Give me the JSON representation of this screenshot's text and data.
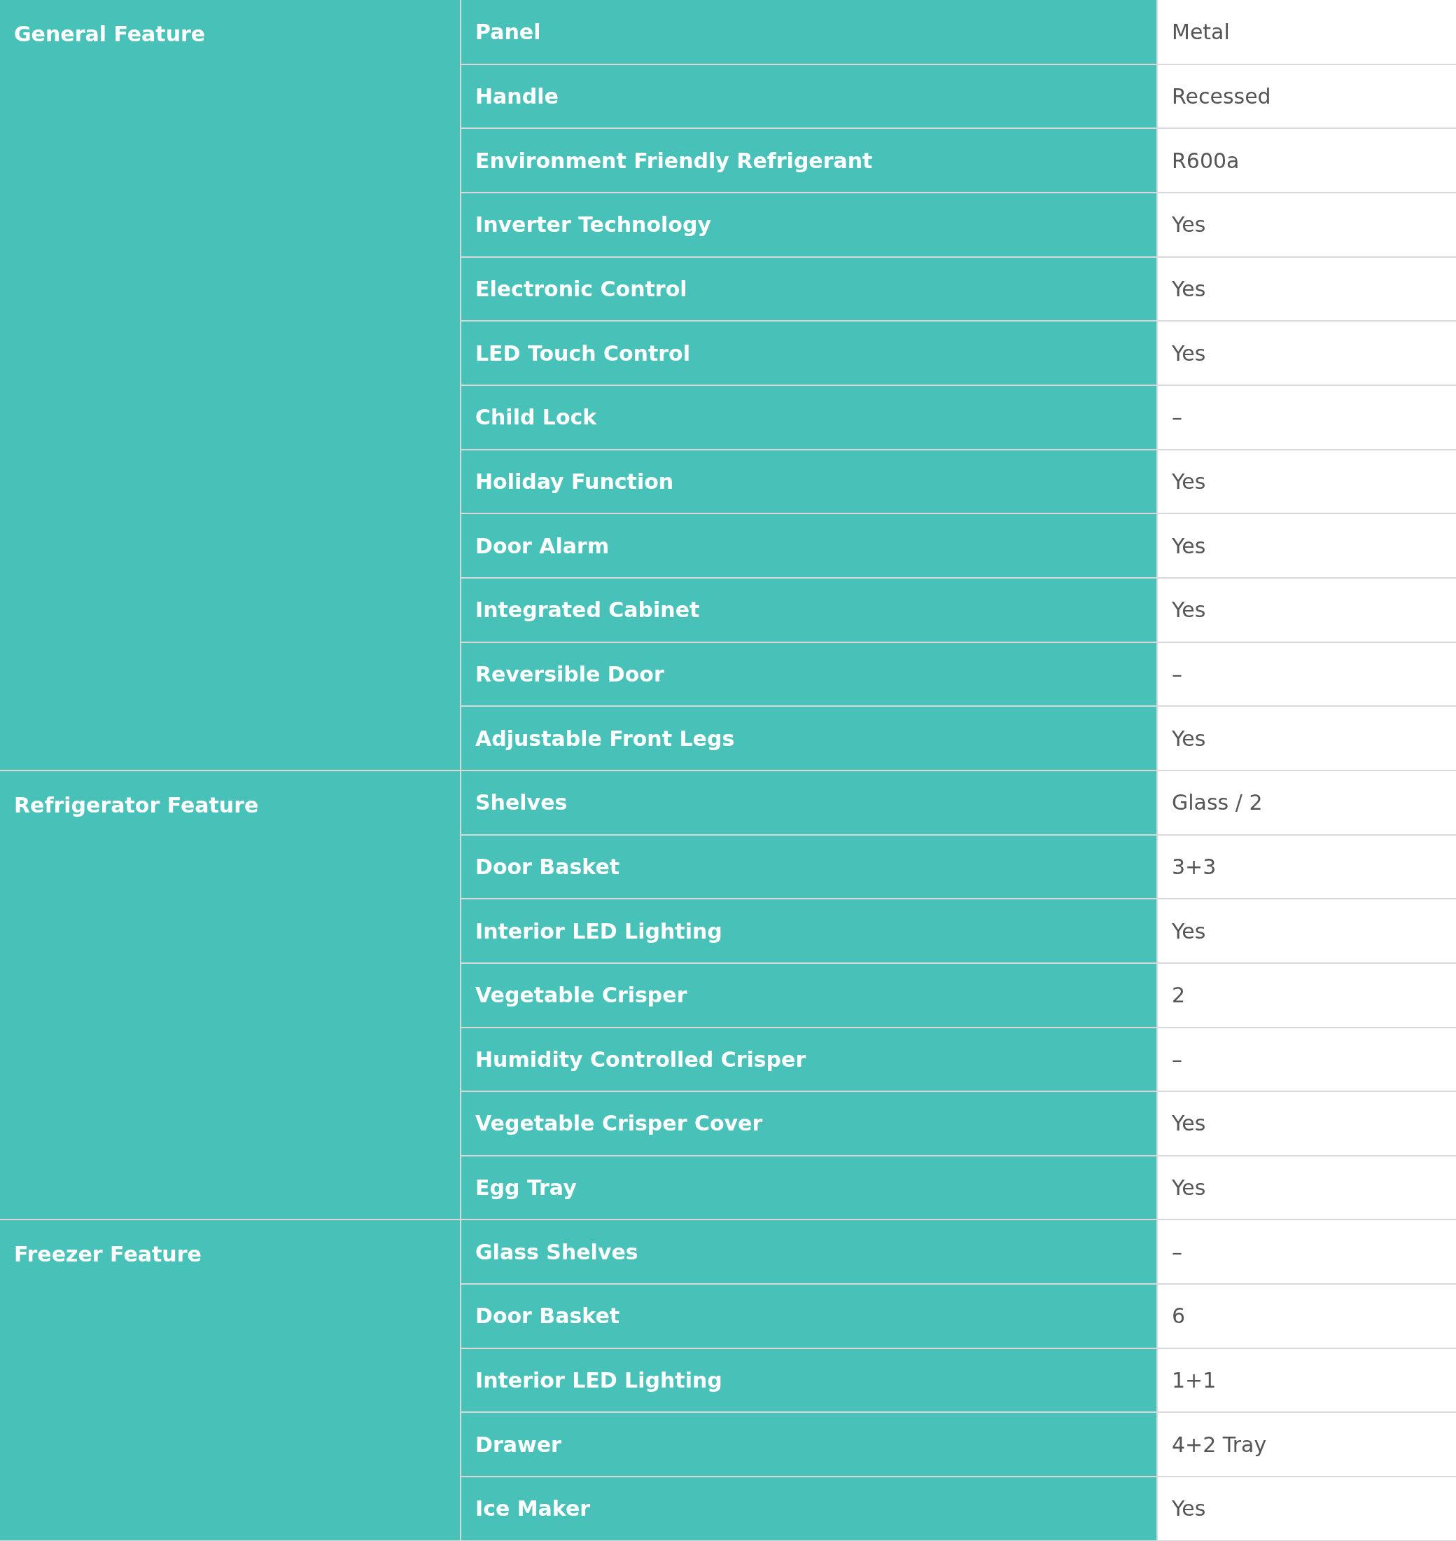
{
  "groups": [
    {
      "name": "General Feature",
      "features": [
        {
          "label": "Panel",
          "value": "Metal"
        },
        {
          "label": "Handle",
          "value": "Recessed"
        },
        {
          "label": "Environment Friendly Refrigerant",
          "value": "R600a"
        },
        {
          "label": "Inverter Technology",
          "value": "Yes"
        },
        {
          "label": "Electronic Control",
          "value": "Yes"
        },
        {
          "label": "LED Touch Control",
          "value": "Yes"
        },
        {
          "label": "Child Lock",
          "value": "–"
        },
        {
          "label": "Holiday Function",
          "value": "Yes"
        },
        {
          "label": "Door Alarm",
          "value": "Yes"
        },
        {
          "label": "Integrated Cabinet",
          "value": "Yes"
        },
        {
          "label": "Reversible Door",
          "value": "–"
        },
        {
          "label": "Adjustable Front Legs",
          "value": "Yes"
        }
      ]
    },
    {
      "name": "Refrigerator Feature",
      "features": [
        {
          "label": "Shelves",
          "value": "Glass / 2"
        },
        {
          "label": "Door Basket",
          "value": "3+3"
        },
        {
          "label": "Interior LED Lighting",
          "value": "Yes"
        },
        {
          "label": "Vegetable Crisper",
          "value": "2"
        },
        {
          "label": "Humidity Controlled Crisper",
          "value": "–"
        },
        {
          "label": "Vegetable Crisper Cover",
          "value": "Yes"
        },
        {
          "label": "Egg Tray",
          "value": "Yes"
        }
      ]
    },
    {
      "name": "Freezer Feature",
      "features": [
        {
          "label": "Glass Shelves",
          "value": "–"
        },
        {
          "label": "Door Basket",
          "value": "6"
        },
        {
          "label": "Interior LED Lighting",
          "value": "1+1"
        },
        {
          "label": "Drawer",
          "value": "4+2 Tray"
        },
        {
          "label": "Ice Maker",
          "value": "Yes"
        }
      ]
    }
  ]
}
